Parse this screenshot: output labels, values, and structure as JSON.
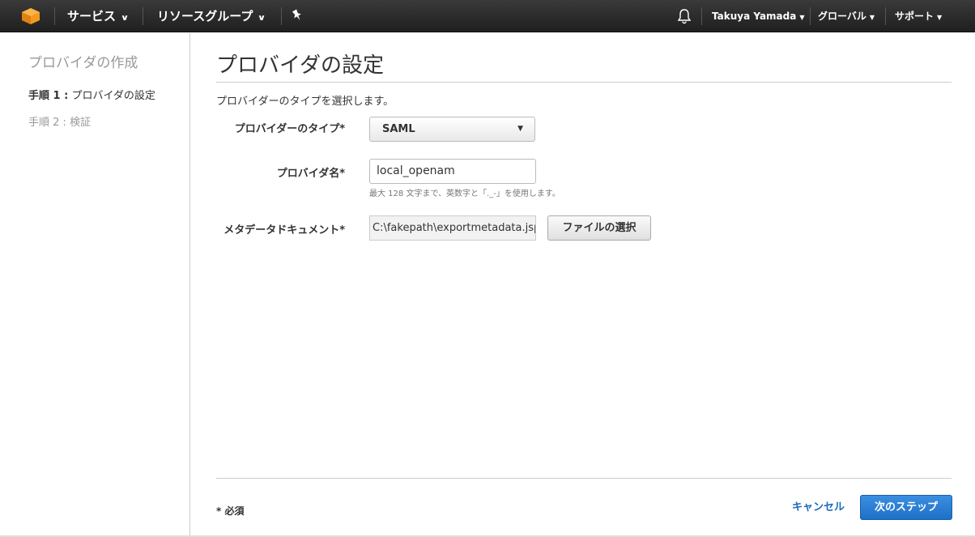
{
  "topnav": {
    "services_label": "サービス",
    "resource_groups_label": "リソースグループ",
    "user_label": "Takuya Yamada",
    "region_label": "グローバル",
    "support_label": "サポート",
    "caret": "⌄",
    "small_caret": "▾",
    "icons": {
      "logo": "aws-cube-icon",
      "pin": "pin-icon",
      "bell": "bell-icon"
    }
  },
  "sidebar": {
    "title": "プロバイダの作成",
    "steps": [
      {
        "prefix": "手順 1 :",
        "label": "プロバイダの設定",
        "active": true
      },
      {
        "prefix": "手順 2 :",
        "label": "検証",
        "active": false
      }
    ]
  },
  "main": {
    "title": "プロバイダの設定",
    "description": "プロバイダーのタイプを選択します。",
    "provider_type": {
      "label": "プロバイダーのタイプ*",
      "value": "SAML"
    },
    "provider_name": {
      "label": "プロバイダ名*",
      "value": "local_openam",
      "hint": "最大 128 文字まで、英数字と「._-」を使用します。"
    },
    "metadata": {
      "label": "メタデータドキュメント*",
      "file_value": "C:\\fakepath\\exportmetadata.jsp",
      "button_label": "ファイルの選択"
    }
  },
  "footer": {
    "required_note": "* 必須",
    "cancel_label": "キャンセル",
    "next_label": "次のステップ"
  },
  "colors": {
    "nav_background": "#232323",
    "logo_orange": "#f29a1f",
    "link_blue": "#1a6bb8",
    "primary_button": "#2a7fd4"
  }
}
